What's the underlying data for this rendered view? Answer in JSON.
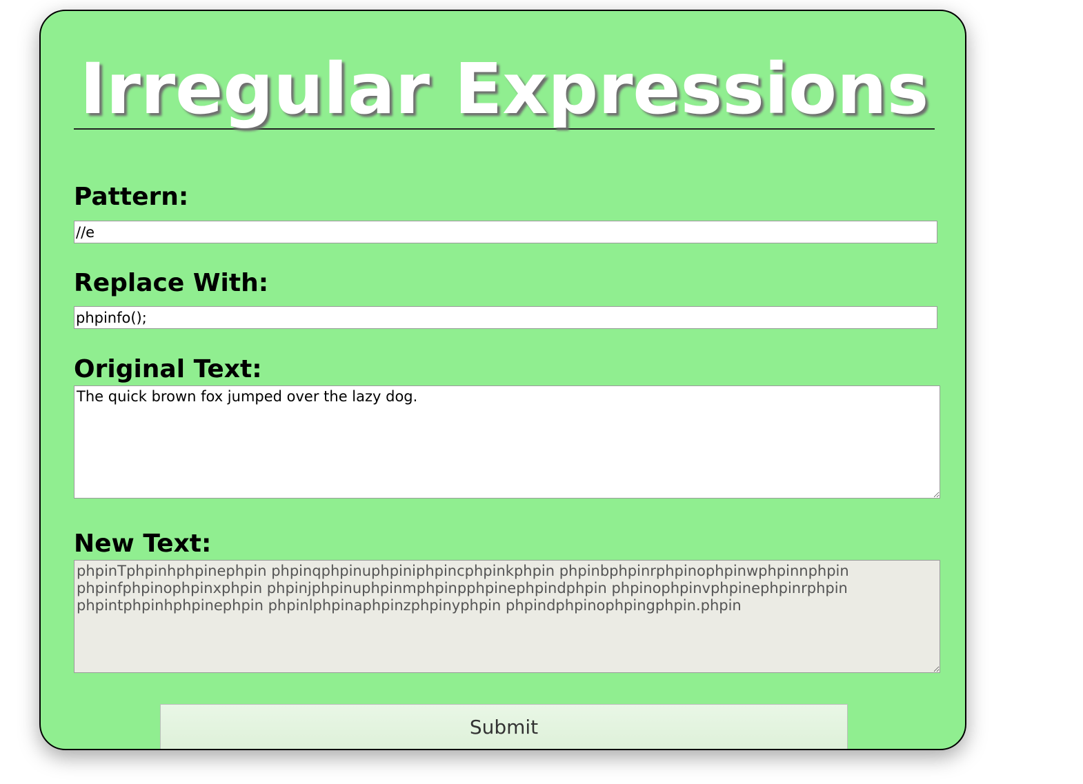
{
  "page": {
    "title": "Irregular Expressions"
  },
  "form": {
    "pattern_label": "Pattern:",
    "pattern_value": "//e",
    "replace_label": "Replace With:",
    "replace_value": "phpinfo();",
    "original_label": "Original Text:",
    "original_value": "The quick brown fox jumped over the lazy dog.",
    "new_label": "New Text:",
    "new_value": "phpinTphpinhphpinephpin phpinqphpinuphpiniphpincphpinkphpin phpinbphpinrphpinophpinwphpinnphpin phpinfphpinophpinxphpin phpinjphpinuphpinmphpinpphpinephpindphpin phpinophpinvphpinephpinrphpin phpintphpinhphpinephpin phpinlphpinaphpinzphpinyphpin phpindphpinophpingphpin.phpin",
    "submit_label": "Submit"
  },
  "colors": {
    "card_background": "#90ee90",
    "title_text": "#ffffff",
    "readonly_background": "#ebebe4"
  }
}
